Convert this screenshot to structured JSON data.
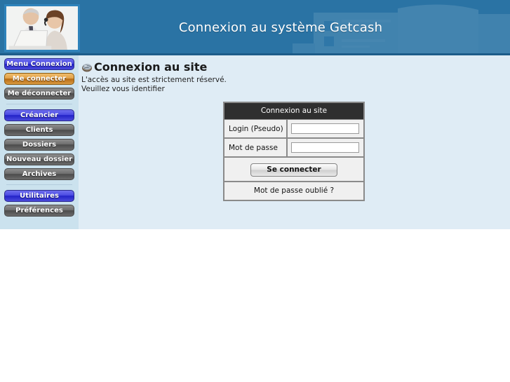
{
  "header": {
    "title": "Connexion au système Getcash",
    "photo_alt": "business-people-photo",
    "bg_color": "#2a73a4"
  },
  "sidebar": {
    "groups": [
      {
        "items": [
          {
            "label": "Menu Connexion",
            "style": "blue",
            "name": "menu-connexion"
          },
          {
            "label": "Me connecter",
            "style": "orange",
            "name": "me-connecter"
          },
          {
            "label": "Me déconnecter",
            "style": "grey",
            "name": "me-deconnecter"
          }
        ]
      },
      {
        "items": [
          {
            "label": "Créancier",
            "style": "blue",
            "name": "creancier"
          },
          {
            "label": "Clients",
            "style": "grey",
            "name": "clients"
          },
          {
            "label": "Dossiers",
            "style": "grey",
            "name": "dossiers"
          },
          {
            "label": "Nouveau dossier",
            "style": "grey",
            "name": "nouveau-dossier"
          },
          {
            "label": "Archives",
            "style": "grey",
            "name": "archives"
          }
        ]
      },
      {
        "items": [
          {
            "label": "Utilitaires",
            "style": "blue",
            "name": "utilitaires"
          },
          {
            "label": "Préférences",
            "style": "grey",
            "name": "preferences"
          }
        ]
      }
    ]
  },
  "content": {
    "heading": "Connexion au site",
    "heading_icon": "globe-icon",
    "subtitle_line1": "L'accès au site est strictement réservé.",
    "subtitle_line2": "Veuillez vous identifier"
  },
  "login_form": {
    "title": "Connexion au site",
    "fields": [
      {
        "label": "Login (Pseudo)",
        "value": "",
        "placeholder": "",
        "type": "text",
        "name": "login"
      },
      {
        "label": "Mot de passe",
        "value": "",
        "placeholder": "",
        "type": "password",
        "name": "password"
      }
    ],
    "submit_label": "Se connecter",
    "forgot_label": "Mot de passe oublié ?",
    "title_bg": "#2f2f2f",
    "cell_bg": "#f0f0f0"
  },
  "colors": {
    "header_blue": "#2a73a4",
    "sidebar_blue": "#cbe2ee",
    "content_blue": "#dfecf5",
    "page_white": "#ffffff"
  }
}
